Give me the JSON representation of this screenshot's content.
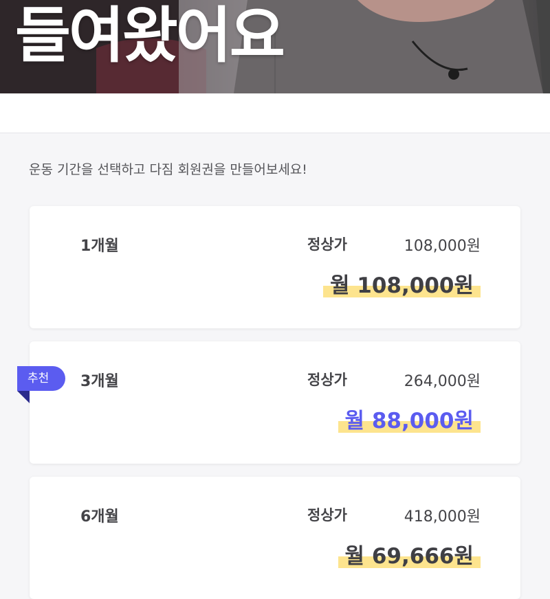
{
  "hero": {
    "title": "들여왔어요"
  },
  "instruction": "운동 기간을 선택하고 다짐 회원권을 만들어보세요!",
  "plans": [
    {
      "duration": "1개월",
      "regular_label": "정상가",
      "regular_price": "108,000원",
      "monthly_price": "월 108,000원"
    },
    {
      "duration": "3개월",
      "regular_label": "정상가",
      "regular_price": "264,000원",
      "monthly_price": "월 88,000원",
      "badge": "추천"
    },
    {
      "duration": "6개월",
      "regular_label": "정상가",
      "regular_price": "418,000원",
      "monthly_price": "월 69,666원"
    }
  ],
  "colors": {
    "accent": "#5b5cf0",
    "highlight": "#fde48e",
    "badge_fold": "#2a2a8c",
    "text_dark": "#444448"
  }
}
